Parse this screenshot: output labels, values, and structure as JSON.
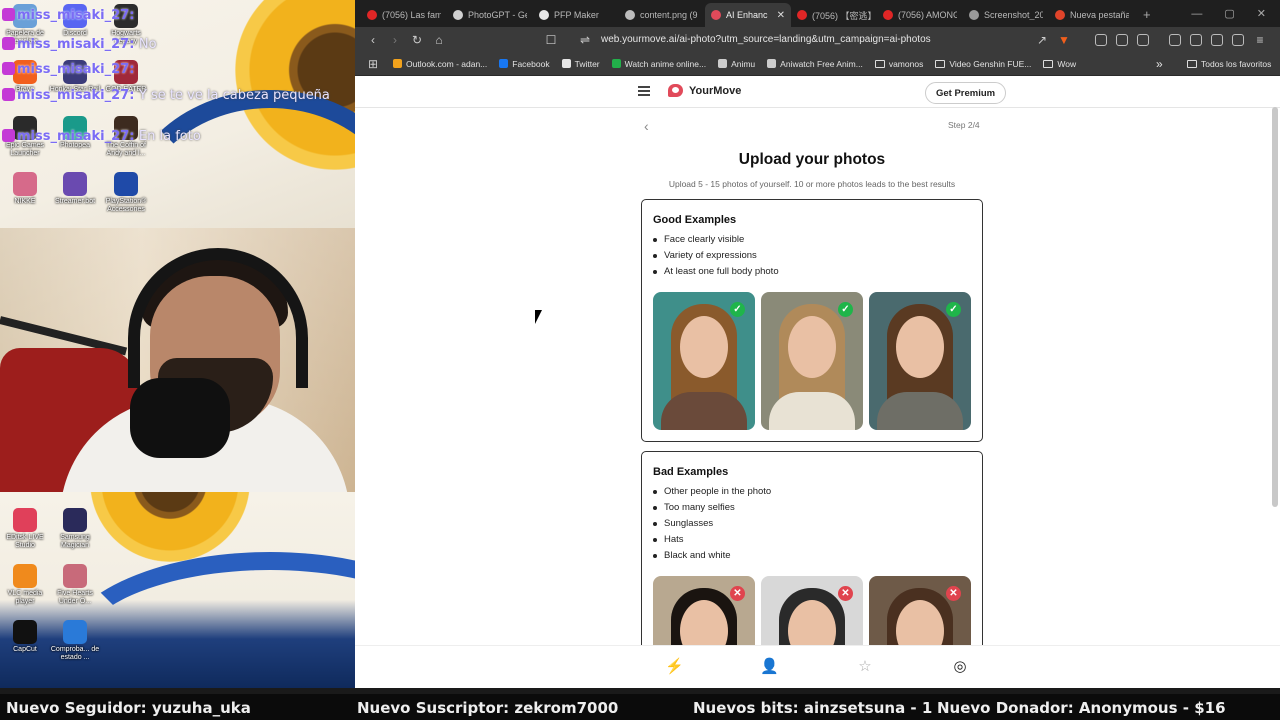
{
  "overlay": {
    "chat": [
      {
        "user": "miss_misaki_27",
        "msg": ""
      },
      {
        "user": "miss_misaki_27",
        "msg": "No"
      },
      {
        "user": "miss_misaki_27",
        "msg": ""
      },
      {
        "user": "miss_misaki_27",
        "msg": "Y se te ve la cabeza pequeña"
      },
      {
        "user": "miss_misaki_27",
        "msg": "En la foto"
      }
    ],
    "desktop_icons_top": [
      {
        "label": "Papelera de reciclaje",
        "color": "#6aa0d8"
      },
      {
        "label": "Discord",
        "color": "#5865f2"
      },
      {
        "label": "Hogwarts Legacy",
        "color": "#2c2c2c"
      },
      {
        "label": "Brave",
        "color": "#f25f1c"
      },
      {
        "label": "Honkai Star Rail",
        "color": "#3b3b7a"
      },
      {
        "label": "GOD EATER",
        "color": "#a0283a"
      },
      {
        "label": "Epic Games Launcher",
        "color": "#2a2a2a"
      },
      {
        "label": "Photopea",
        "color": "#1a9a8a"
      },
      {
        "label": "The Coffin of Andy and l...",
        "color": "#3d2b1f"
      },
      {
        "label": "NIKKE",
        "color": "#d66a8a"
      },
      {
        "label": "Streamer.bot",
        "color": "#6a4ab0"
      },
      {
        "label": "PlayStation® Accessories",
        "color": "#1f4aa8"
      }
    ],
    "desktop_icons_bottom": [
      {
        "label": "EDitsk LIVE Studio",
        "color": "#e0405a"
      },
      {
        "label": "Samsung Magician",
        "color": "#2a2a5a"
      },
      {
        "label": "VLC media player",
        "color": "#f08a1c"
      },
      {
        "label": "Five Hearts Under O...",
        "color": "#c86a7a"
      },
      {
        "label": "CapCut",
        "color": "#111111"
      },
      {
        "label": "Comproba... de estado ...",
        "color": "#2a7ad8"
      }
    ],
    "ticker": [
      "Nuevo Seguidor: yuzuha_uka",
      "Nuevo Suscriptor: zekrom7000",
      "Nuevos bits: ainzsetsuna - 1",
      "Nuevo Donador: Anonymous - $16"
    ]
  },
  "browser": {
    "tabs": [
      {
        "title": "(7056) Las fam",
        "color": "#e02626",
        "active": false
      },
      {
        "title": "PhotoGPT - Ge",
        "color": "#d0d0d0",
        "active": false
      },
      {
        "title": "PFP Maker",
        "color": "#e8e8e8",
        "active": false
      },
      {
        "title": "content.png (9",
        "color": "#bcbcbc",
        "active": false
      },
      {
        "title": "AI Enhanc",
        "color": "#e14a5a",
        "active": true
      },
      {
        "title": "(7056) 【密逃】",
        "color": "#e02626",
        "active": false
      },
      {
        "title": "(7056) AMONG",
        "color": "#e02626",
        "active": false
      },
      {
        "title": "Screenshot_20",
        "color": "#9a9a9a",
        "active": false
      },
      {
        "title": "Nueva pestaña",
        "color": "#e0442a",
        "active": false
      }
    ],
    "new_tab_glyph": "+",
    "url": "web.yourmove.ai/ai-photo?utm_source=landing&utm_campaign=ai-photos",
    "bookmarks": [
      {
        "label": "Outlook.com - adan...",
        "color": "#f2a21c"
      },
      {
        "label": "Facebook",
        "color": "#1877f2"
      },
      {
        "label": "Twitter",
        "color": "#e6e6e6"
      },
      {
        "label": "Watch anime online...",
        "color": "#22b04a"
      },
      {
        "label": "Animu",
        "color": "#cccccc"
      },
      {
        "label": "Aniwatch Free Anim...",
        "color": "#cccccc"
      },
      {
        "label": "vamonos",
        "color": "folder"
      },
      {
        "label": "Video Genshin FUE...",
        "color": "folder"
      },
      {
        "label": "Wow",
        "color": "folder"
      }
    ],
    "bookmarks_more": "»",
    "all_bookmarks": "Todos los favoritos"
  },
  "page": {
    "brand": "YourMove",
    "premium_label": "Get Premium",
    "step": "Step 2/4",
    "heading": "Upload your photos",
    "subheading": "Upload 5 - 15 photos of yourself. 10 or more photos leads to the best results",
    "good": {
      "title": "Good Examples",
      "items": [
        "Face clearly visible",
        "Variety of expressions",
        "At least one full body photo"
      ],
      "photo_colors": [
        {
          "bg": "#3f8f8a",
          "hair": "#8a5a2c",
          "body": "#6a4a3a"
        },
        {
          "bg": "#8a8a78",
          "hair": "#b08a5a",
          "body": "#e8e2d4"
        },
        {
          "bg": "#4a6a6e",
          "hair": "#5a3a22",
          "body": "#6e6e66"
        }
      ]
    },
    "bad": {
      "title": "Bad Examples",
      "items": [
        "Other people in the photo",
        "Too many selfies",
        "Sunglasses",
        "Hats",
        "Black and white"
      ],
      "photo_colors": [
        {
          "bg": "#b8a890",
          "hair": "#1a1410",
          "body": "#3a3a3a"
        },
        {
          "bg": "#d8d8d8",
          "hair": "#2a2a2a",
          "body": "#444444"
        },
        {
          "bg": "#6e5a48",
          "hair": "#4a3020",
          "body": "#3a2a20"
        }
      ]
    },
    "nav_icons": [
      "sparkle-photo-icon",
      "user-edit-icon",
      "star-badge-icon",
      "aperture-icon"
    ]
  }
}
